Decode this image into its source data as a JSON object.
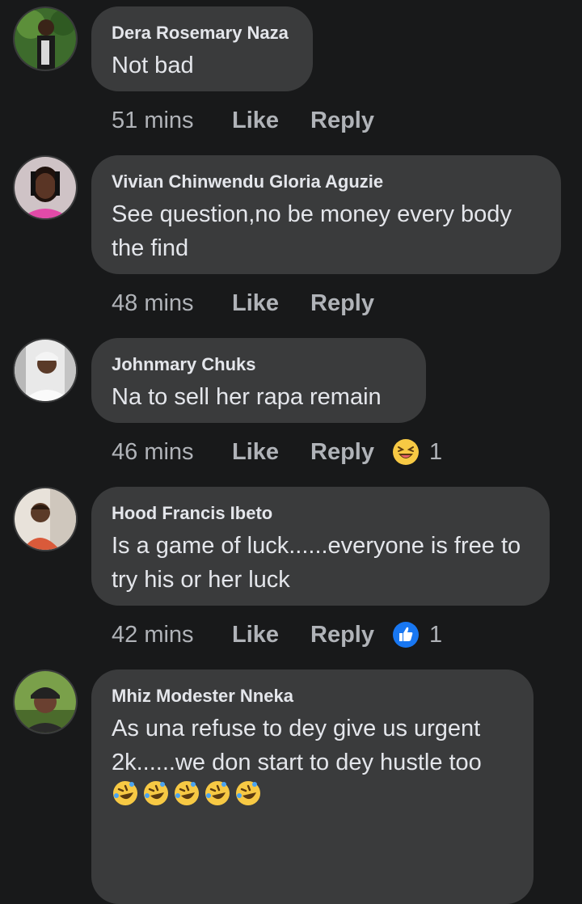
{
  "comments": [
    {
      "name": "Dera Rosemary Naza",
      "text": "Not bad",
      "time": "51 mins",
      "like": "Like",
      "reply": "Reply"
    },
    {
      "name": "Vivian Chinwendu Gloria Aguzie",
      "text": "See question,no be money every body the find",
      "time": "48 mins",
      "like": "Like",
      "reply": "Reply"
    },
    {
      "name": "Johnmary Chuks",
      "text": "Na to sell her rapa remain",
      "time": "46 mins",
      "like": "Like",
      "reply": "Reply",
      "reaction": {
        "icon": "laughing-emoji-icon",
        "count": "1"
      }
    },
    {
      "name": "Hood Francis Ibeto",
      "text": "Is a game of luck......everyone is free to try his or her luck",
      "time": "42 mins",
      "like": "Like",
      "reply": "Reply",
      "reaction": {
        "icon": "thumbs-up-icon",
        "count": "1"
      }
    },
    {
      "name": "Mhiz Modester Nneka",
      "text": "As una refuse to dey give us urgent 2k......we don start to dey hustle too",
      "time": "",
      "like": "",
      "reply": "",
      "emoji_trail": [
        "rofl-emoji-icon",
        "rofl-emoji-icon",
        "rofl-emoji-icon",
        "rofl-emoji-icon",
        "rofl-emoji-icon"
      ]
    }
  ],
  "colors": {
    "background": "#18191a",
    "bubble": "#3a3b3c",
    "text": "#e4e6eb",
    "muted": "#b0b3b8",
    "like_blue": "#1877f2"
  }
}
